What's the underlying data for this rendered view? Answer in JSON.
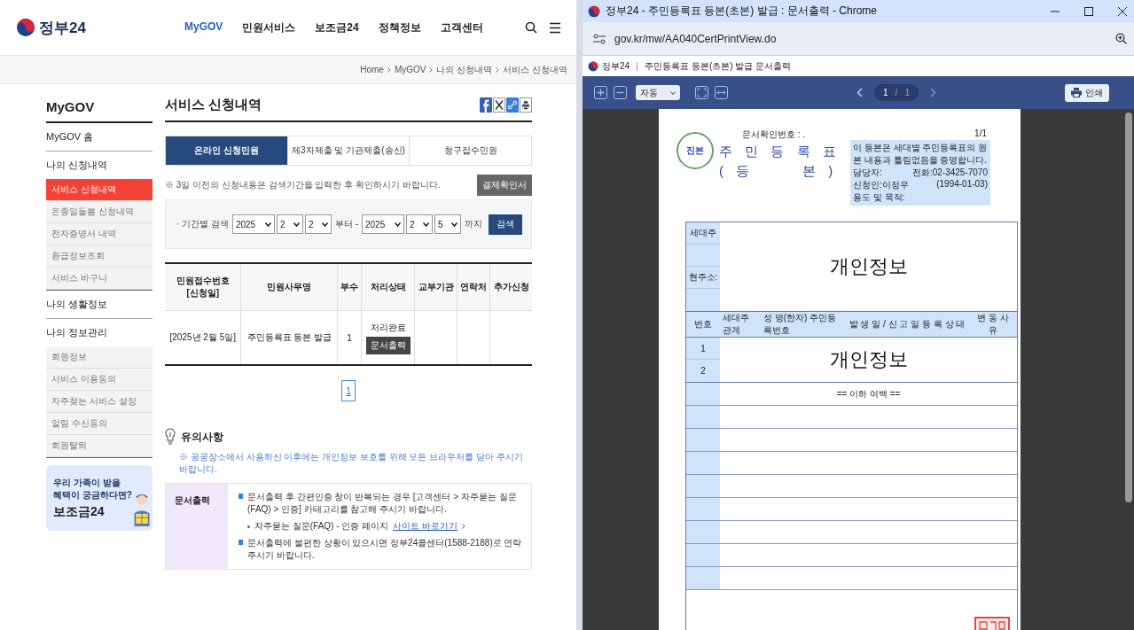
{
  "site": {
    "logo": "정부24",
    "nav": [
      {
        "label": "MyGOV",
        "selected": true
      },
      {
        "label": "민원서비스",
        "selected": false
      },
      {
        "label": "보조금24",
        "selected": false
      },
      {
        "label": "정책정보",
        "selected": false
      },
      {
        "label": "고객센터",
        "selected": false
      }
    ],
    "breadcrumb": [
      "Home",
      "MyGOV",
      "나의 신청내역",
      "서비스 신청내역"
    ]
  },
  "sidebar": {
    "title": "MyGOV",
    "groups": [
      {
        "label": "MyGOV 홈"
      },
      {
        "label": "나의 신청내역",
        "children": [
          {
            "label": "서비스 신청내역",
            "selected": true
          },
          {
            "label": "온종일돌봄 신청내역",
            "selected": false
          },
          {
            "label": "전자증명서 내역",
            "selected": false
          },
          {
            "label": "환급정보조회",
            "selected": false
          },
          {
            "label": "서비스 바구니",
            "selected": false
          }
        ]
      },
      {
        "label": "나의 생활정보"
      },
      {
        "label": "나의 정보관리",
        "children": [
          {
            "label": "회원정보",
            "selected": false
          },
          {
            "label": "서비스 이용동의",
            "selected": false
          },
          {
            "label": "자주찾는 서비스 설정",
            "selected": false
          },
          {
            "label": "알림 수신동의",
            "selected": false
          },
          {
            "label": "회원탈퇴",
            "selected": false
          }
        ]
      }
    ]
  },
  "banner": {
    "lines": [
      "우리 가족이 받을",
      "혜택이 궁금하다면?"
    ],
    "title": "보조금24"
  },
  "main": {
    "title": "서비스 신청내역",
    "tabs": [
      {
        "label": "온라인 신청민원",
        "selected": true
      },
      {
        "label": "제3자제출 및 기관제출(송신)",
        "selected": false
      },
      {
        "label": "청구접수민원",
        "selected": false
      }
    ],
    "note": "※ 3일 이전의 신청내용은 검색기간을 입력한 후 확인하시기 바랍니다.",
    "receipt_button": "결제확인서",
    "search": {
      "label": "· 기간별 검색",
      "from": [
        "2025",
        "2",
        "2"
      ],
      "from_suffix": "부터 -",
      "to": [
        "2025",
        "2",
        "5"
      ],
      "to_suffix": "까지",
      "button": "검색"
    },
    "table": {
      "columns": [
        [
          "민원접수번호",
          "[신청일]"
        ],
        [
          "민원사무명"
        ],
        [
          "부수"
        ],
        [
          "처리상태"
        ],
        [
          "교부기관"
        ],
        [
          "연락처"
        ],
        [
          "추가신청"
        ]
      ],
      "rows": [
        {
          "receipt": "[2025년 2월 5일]",
          "name": "주민등록표 등본 발급",
          "copies": "1",
          "status": "처리완료",
          "action": "문서출력"
        }
      ]
    },
    "pagination": [
      {
        "label": "1",
        "selected": true
      }
    ],
    "notice": {
      "title": "유의사항",
      "note": "※ 공공장소에서 사용하신 이후에는 개인정보 보호를 위해 모든 브라우저를 닫아 주시기 바랍니다.",
      "box": {
        "label": "문서출력",
        "items": [
          {
            "kind": "bullet",
            "text": "문서출력 후 간편인증 창이 반복되는 경우 [고객센터 > 자주묻는 질문(FAQ) > 인증] 카테고리를 참고해 주시기 바랍니다."
          },
          {
            "kind": "sub",
            "text": "자주묻는 질문(FAQ) - 인증 페이지",
            "link": "사이트 바로가기"
          },
          {
            "kind": "bullet",
            "text": "문서출력에 불편한 상황이 있으시면 정부24콜센터(1588-2188)로 연락주시기 바랍니다."
          }
        ]
      }
    }
  },
  "browser": {
    "title": "정부24 - 주민등록표 등본(초본) 발급 : 문서출력 - Chrome",
    "url": "gov.kr/mw/AA040CertPrintView.do",
    "page_header": {
      "logo": "정부24",
      "title": "주민등록표 등본(초본) 발급 문서출력"
    },
    "viewer": {
      "zoom": "자동",
      "page": "1",
      "separator": "/",
      "total": "1",
      "print": "인쇄"
    },
    "document": {
      "number_label": "문서확인번호 : .",
      "page_count": "1/1",
      "stamp": "진본",
      "title": "주 민 등 록 표",
      "subtitle": "( 등      본 )",
      "certificate": "이 등본은 세대별 주민등록표의 원본 내용과 틀림없음을 증명합니다.",
      "fields": [
        {
          "label": "담당자:",
          "value": "전화:02-3425-7070"
        },
        {
          "label": "신청인:이정우",
          "value": "(1994-01-03)"
        },
        {
          "label": "용도 및 목적:"
        }
      ],
      "household_labels": [
        {
          "label": "세대주"
        },
        {
          "label": "현주소:"
        }
      ],
      "cover_top": "개인정보",
      "cover_rows": "개인정보",
      "columns": [
        "번호",
        "세대주 관계",
        "성 명(한자) 주민등록번호",
        "발 생 일 / 신 고 일 등 록 상 태",
        "변 동 사 유"
      ],
      "row_numbers": [
        "1",
        "2"
      ],
      "end_mark": "== 이하 여백 =="
    }
  }
}
